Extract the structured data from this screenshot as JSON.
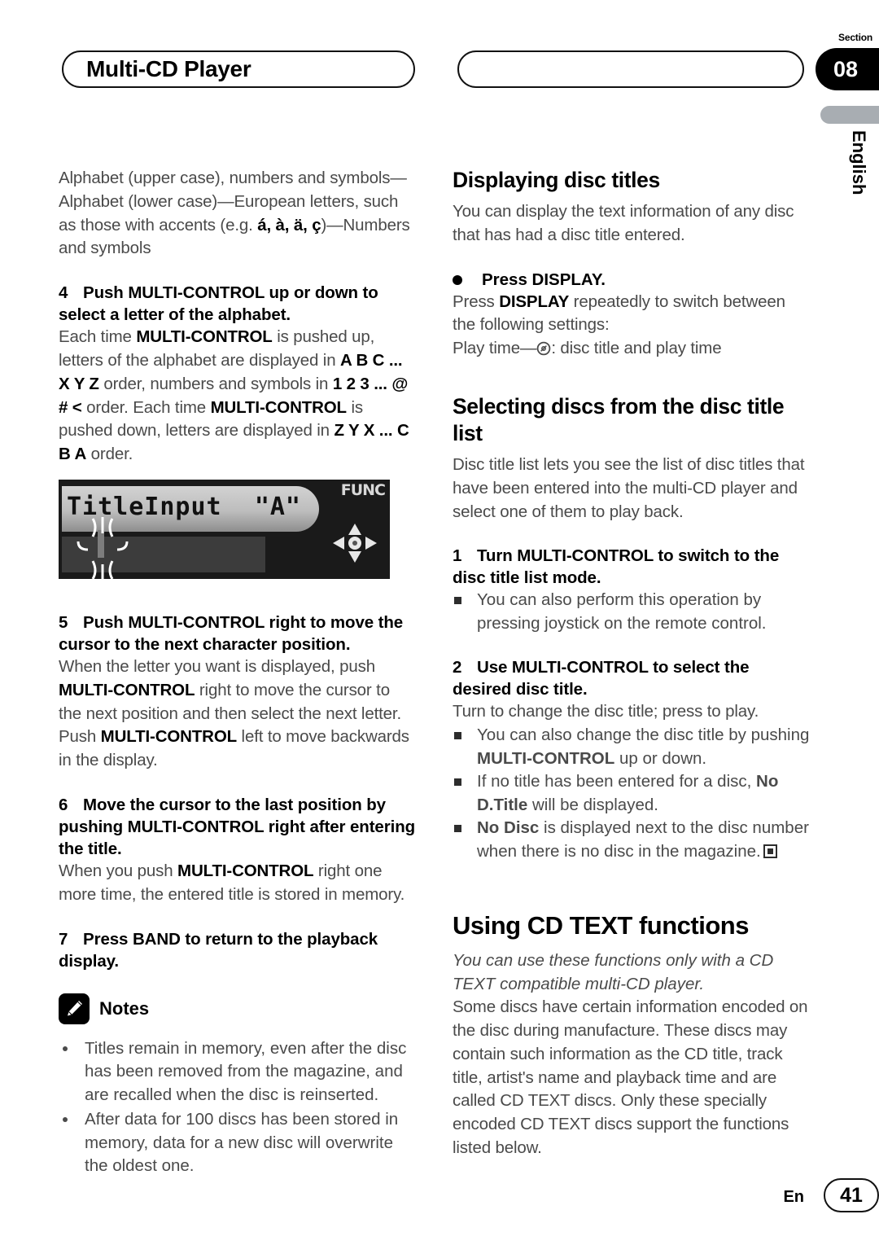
{
  "header": {
    "chapter_title": "Multi-CD Player",
    "section_label": "Section",
    "section_number": "08",
    "language_tab": "English"
  },
  "left_column": {
    "intro_paragraph": "Alphabet (upper case), numbers and symbols—Alphabet (lower case)—European letters, such as those with accents (e.g. á, à, ä, ç)—Numbers and symbols",
    "intro_parts": {
      "p1": "Alphabet (upper case), numbers and symbols—Alphabet (lower case)—European letters, such as those with accents (e.g. ",
      "accents": "á, à, ä, ç",
      "p2": ")—Numbers and symbols"
    },
    "step4": {
      "number": "4",
      "title": "Push MULTI-CONTROL up or down to select a letter of the alphabet.",
      "body": {
        "t1": "Each time ",
        "b1": "MULTI-CONTROL",
        "t2": " is pushed up, letters of the alphabet are displayed in ",
        "b2": "A B C ... X Y Z",
        "t3": " order, numbers and symbols in ",
        "b3": "1 2 3 ... @ # <",
        "t4": " order. Each time ",
        "b4": "MULTI-CONTROL",
        "t5": " is pushed down, letters are displayed in ",
        "b5": "Z Y X ... C B A",
        "t6": " order."
      }
    },
    "figure": {
      "display_text": "TitleInput",
      "display_value": "\"A\"",
      "func_label": "FUNC"
    },
    "step5": {
      "number": "5",
      "title": "Push MULTI-CONTROL right to move the cursor to the next character position.",
      "body": {
        "t1": "When the letter you want is displayed, push ",
        "b1": "MULTI-CONTROL",
        "t2": " right to move the cursor to the next position and then select the next letter. Push ",
        "b2": "MULTI-CONTROL",
        "t3": " left to move backwards in the display."
      }
    },
    "step6": {
      "number": "6",
      "title": "Move the cursor to the last position by pushing MULTI-CONTROL right after entering the title.",
      "body": {
        "t1": "When you push ",
        "b1": "MULTI-CONTROL",
        "t2": " right one more time, the entered title is stored in memory."
      }
    },
    "step7": {
      "number": "7",
      "title": "Press BAND to return to the playback display."
    },
    "notes": {
      "heading": "Notes",
      "icon": "pencil-icon",
      "items": [
        "Titles remain in memory, even after the disc has been removed from the magazine, and are recalled when the disc is reinserted.",
        "After data for 100 discs has been stored in memory, data for a new disc will overwrite the oldest one."
      ]
    }
  },
  "right_column": {
    "section_displaying": {
      "heading": "Displaying disc titles",
      "intro": "You can display the text information of any disc that has had a disc title entered.",
      "action": "Press DISPLAY.",
      "body": {
        "t1": "Press ",
        "b1": "DISPLAY",
        "t2": " repeatedly to switch between the following settings:"
      },
      "settings_line_pre": "Play time—",
      "settings_line_post": ": disc title and play time",
      "disc_icon": "disc-icon"
    },
    "section_selecting": {
      "heading": "Selecting discs from the disc title list",
      "intro": "Disc title list lets you see the list of disc titles that have been entered into the multi-CD player and select one of them to play back.",
      "step1": {
        "number": "1",
        "title": "Turn MULTI-CONTROL to switch to the disc title list mode.",
        "note": "You can also perform this operation by pressing joystick on the remote control."
      },
      "step2": {
        "number": "2",
        "title": "Use MULTI-CONTROL to select the desired disc title.",
        "body": "Turn to change the disc title; press to play.",
        "notes": [
          {
            "t1": "You can also change the disc title by pushing ",
            "b1": "MULTI-CONTROL",
            "t2": " up or down."
          },
          {
            "t1": "If no title has been entered for a disc, ",
            "b1": "No D.Title",
            "t2": " will be displayed."
          },
          {
            "t1": "",
            "b1": "No Disc",
            "t2": " is displayed next to the disc number when there is no disc in the magazine."
          }
        ]
      }
    },
    "section_cdtext": {
      "heading": "Using CD TEXT functions",
      "italic_note": "You can use these functions only with a CD TEXT compatible multi-CD player.",
      "body": "Some discs have certain information encoded on the disc during manufacture. These discs may contain such information as the CD title, track title, artist's name and playback time and are called CD TEXT discs. Only these specially encoded CD TEXT discs support the functions listed below."
    }
  },
  "footer": {
    "language": "En",
    "page_number": "41"
  },
  "colors": {
    "accent_black": "#000000",
    "body_gray": "#4a4a4a",
    "tab_gray": "#a8adb2"
  }
}
